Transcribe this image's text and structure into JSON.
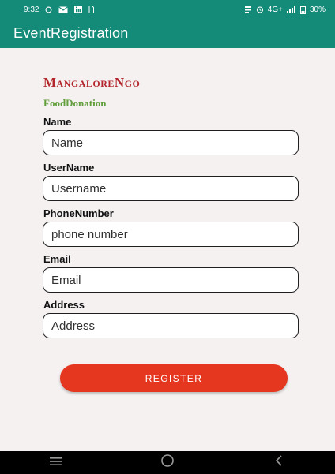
{
  "status_bar": {
    "time": "9:32",
    "network_label": "4G+",
    "battery": "30%",
    "icons": [
      "whatsapp-icon",
      "mail-icon",
      "linkedin-icon",
      "sim-icon",
      "data-speed-icon",
      "alarm-icon",
      "signal-icon",
      "battery-icon"
    ]
  },
  "app_bar": {
    "title": "EventRegistration"
  },
  "header": {
    "title": "MangaloreNgo",
    "subtitle": "FoodDonation"
  },
  "form": {
    "fields": [
      {
        "label": "Name",
        "placeholder": "Name"
      },
      {
        "label": "UserName",
        "placeholder": "Username"
      },
      {
        "label": "PhoneNumber",
        "placeholder": "phone number"
      },
      {
        "label": "Email",
        "placeholder": "Email"
      },
      {
        "label": "Address",
        "placeholder": "Address"
      }
    ],
    "register_label": "REGISTER"
  },
  "nav_bar": {
    "icons": [
      "recent-apps-icon",
      "home-icon",
      "back-icon"
    ]
  },
  "colors": {
    "app_bar": "#148a79",
    "title": "#b3262b",
    "subtitle": "#5f9e3b",
    "register": "#e5361f",
    "background": "#f6f1f1"
  }
}
